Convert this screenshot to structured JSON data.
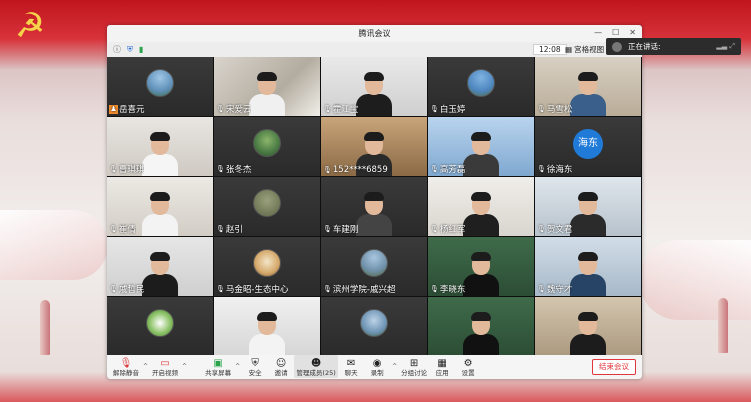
{
  "window": {
    "title": "腾讯会议",
    "time": "12:08",
    "grid_view_label": "宫格视图"
  },
  "speaking": {
    "label": "正在讲话:"
  },
  "participants": [
    {
      "name": "岳喜元",
      "host": true
    },
    {
      "name": "宋爱云"
    },
    {
      "name": "霍江宝"
    },
    {
      "name": "白玉婷"
    },
    {
      "name": "马雪松"
    },
    {
      "name": "曹琪琪"
    },
    {
      "name": "张冬杰"
    },
    {
      "name": "152****6859"
    },
    {
      "name": "高芳磊"
    },
    {
      "name": "徐海东",
      "avatar_text": "海东"
    },
    {
      "name": "崔倩"
    },
    {
      "name": "赵引"
    },
    {
      "name": "车建刚"
    },
    {
      "name": "杨红军"
    },
    {
      "name": "贺文君"
    },
    {
      "name": "戚哲民"
    },
    {
      "name": "马金昭-生态中心"
    },
    {
      "name": "滨州学院-戚兴超"
    },
    {
      "name": "李晓东"
    },
    {
      "name": "魏守才"
    },
    {
      "name": ""
    },
    {
      "name": ""
    },
    {
      "name": ""
    },
    {
      "name": ""
    },
    {
      "name": ""
    }
  ],
  "toolbar": {
    "unmute": "解除静音",
    "video": "开启视频",
    "share": "共享屏幕",
    "security": "安全",
    "invite": "邀请",
    "members": "管理成员(25)",
    "chat": "聊天",
    "record": "录制",
    "breakout": "分组讨论",
    "apps": "应用",
    "settings": "设置",
    "end": "结束会议"
  },
  "icons": {
    "info": "info-icon",
    "shield": "shield-icon",
    "signal": "signal-icon",
    "mic": "mic-icon"
  }
}
